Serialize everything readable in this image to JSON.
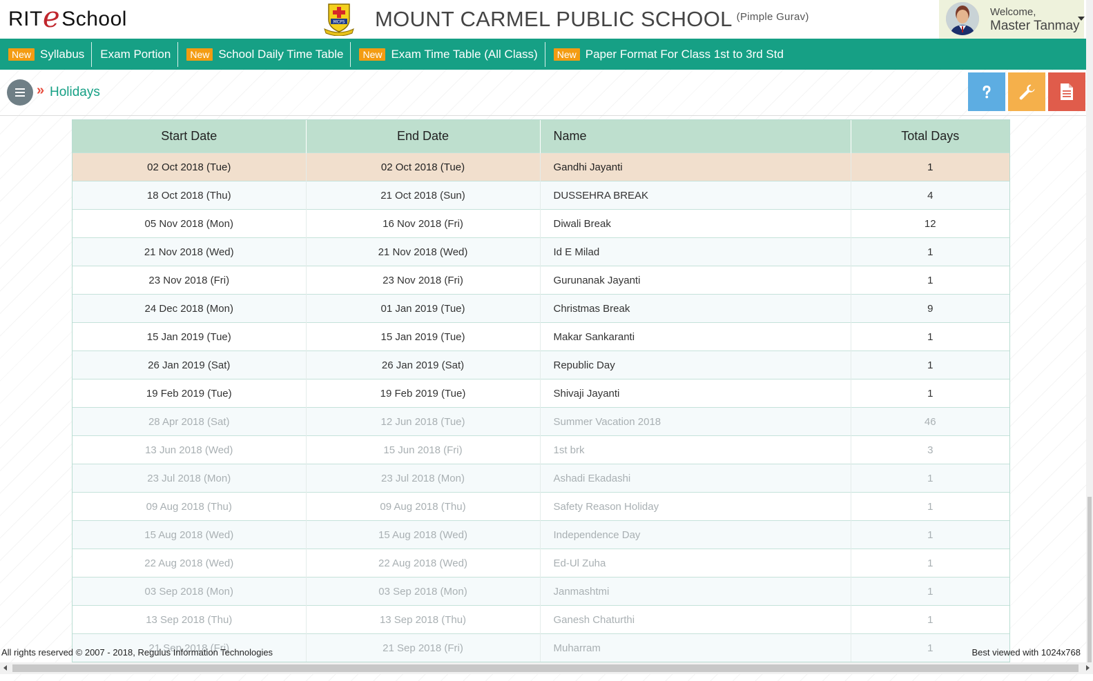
{
  "header": {
    "logo_left": "RIT",
    "logo_e": "e",
    "logo_right": "School",
    "crest_text": "MCPS",
    "school_name": "MOUNT CARMEL PUBLIC SCHOOL",
    "school_location": "(Pimple Gurav)",
    "welcome_label": "Welcome,",
    "user_name": "Master Tanmay"
  },
  "nav": {
    "items": [
      {
        "badge": "New",
        "label": "Syllabus"
      },
      {
        "badge": "",
        "label": "Exam Portion"
      },
      {
        "badge": "New",
        "label": "School Daily Time Table"
      },
      {
        "badge": "New",
        "label": "Exam Time Table (All Class)"
      },
      {
        "badge": "New",
        "label": "Paper Format For Class 1st to 3rd Std"
      }
    ]
  },
  "breadcrumb": {
    "separator": "»",
    "current": "Holidays"
  },
  "toolbar": {
    "help_icon": "question-icon",
    "settings_icon": "wrench-icon",
    "report_icon": "document-icon",
    "help_color": "#5dade2",
    "settings_color": "#f5b04b",
    "report_color": "#e05c4b"
  },
  "colors": {
    "nav_bg": "#16a085",
    "badge_bg": "#f39c12",
    "table_header_bg": "#bedfce",
    "highlight_row_bg": "#f1dfcd"
  },
  "table": {
    "headers": [
      "Start Date",
      "End Date",
      "Name",
      "Total Days"
    ],
    "rows": [
      {
        "start": "02 Oct 2018 (Tue)",
        "end": "02 Oct 2018 (Tue)",
        "name": "Gandhi Jayanti",
        "days": "1"
      },
      {
        "start": "18 Oct 2018 (Thu)",
        "end": "21 Oct 2018 (Sun)",
        "name": "DUSSEHRA BREAK",
        "days": "4"
      },
      {
        "start": "05 Nov 2018 (Mon)",
        "end": "16 Nov 2018 (Fri)",
        "name": "Diwali Break",
        "days": "12"
      },
      {
        "start": "21 Nov 2018 (Wed)",
        "end": "21 Nov 2018 (Wed)",
        "name": "Id E Milad",
        "days": "1"
      },
      {
        "start": "23 Nov 2018 (Fri)",
        "end": "23 Nov 2018 (Fri)",
        "name": "Gurunanak Jayanti",
        "days": "1"
      },
      {
        "start": "24 Dec 2018 (Mon)",
        "end": "01 Jan 2019 (Tue)",
        "name": "Christmas Break",
        "days": "9"
      },
      {
        "start": "15 Jan 2019 (Tue)",
        "end": "15 Jan 2019 (Tue)",
        "name": "Makar Sankaranti",
        "days": "1"
      },
      {
        "start": "26 Jan 2019 (Sat)",
        "end": "26 Jan 2019 (Sat)",
        "name": "Republic Day",
        "days": "1"
      },
      {
        "start": "19 Feb 2019 (Tue)",
        "end": "19 Feb 2019 (Tue)",
        "name": "Shivaji Jayanti",
        "days": "1"
      },
      {
        "start": "28 Apr 2018 (Sat)",
        "end": "12 Jun 2018 (Tue)",
        "name": "Summer Vacation 2018",
        "days": "46"
      },
      {
        "start": "13 Jun 2018 (Wed)",
        "end": "15 Jun 2018 (Fri)",
        "name": "1st brk",
        "days": "3"
      },
      {
        "start": "23 Jul 2018 (Mon)",
        "end": "23 Jul 2018 (Mon)",
        "name": "Ashadi Ekadashi",
        "days": "1"
      },
      {
        "start": "09 Aug 2018 (Thu)",
        "end": "09 Aug 2018 (Thu)",
        "name": "Safety Reason Holiday",
        "days": "1"
      },
      {
        "start": "15 Aug 2018 (Wed)",
        "end": "15 Aug 2018 (Wed)",
        "name": "Independence Day",
        "days": "1"
      },
      {
        "start": "22 Aug 2018 (Wed)",
        "end": "22 Aug 2018 (Wed)",
        "name": "Ed-Ul Zuha",
        "days": "1"
      },
      {
        "start": "03 Sep 2018 (Mon)",
        "end": "03 Sep 2018 (Mon)",
        "name": "Janmashtmi",
        "days": "1"
      },
      {
        "start": "13 Sep 2018 (Thu)",
        "end": "13 Sep 2018 (Thu)",
        "name": "Ganesh Chaturthi",
        "days": "1"
      },
      {
        "start": "21 Sep 2018 (Fri)",
        "end": "21 Sep 2018 (Fri)",
        "name": "Muharram",
        "days": "1"
      }
    ]
  },
  "footer": {
    "copyright": "All rights reserved © 2007 - 2018, Regulus Information Technologies",
    "best_viewed": "Best viewed with 1024x768"
  }
}
